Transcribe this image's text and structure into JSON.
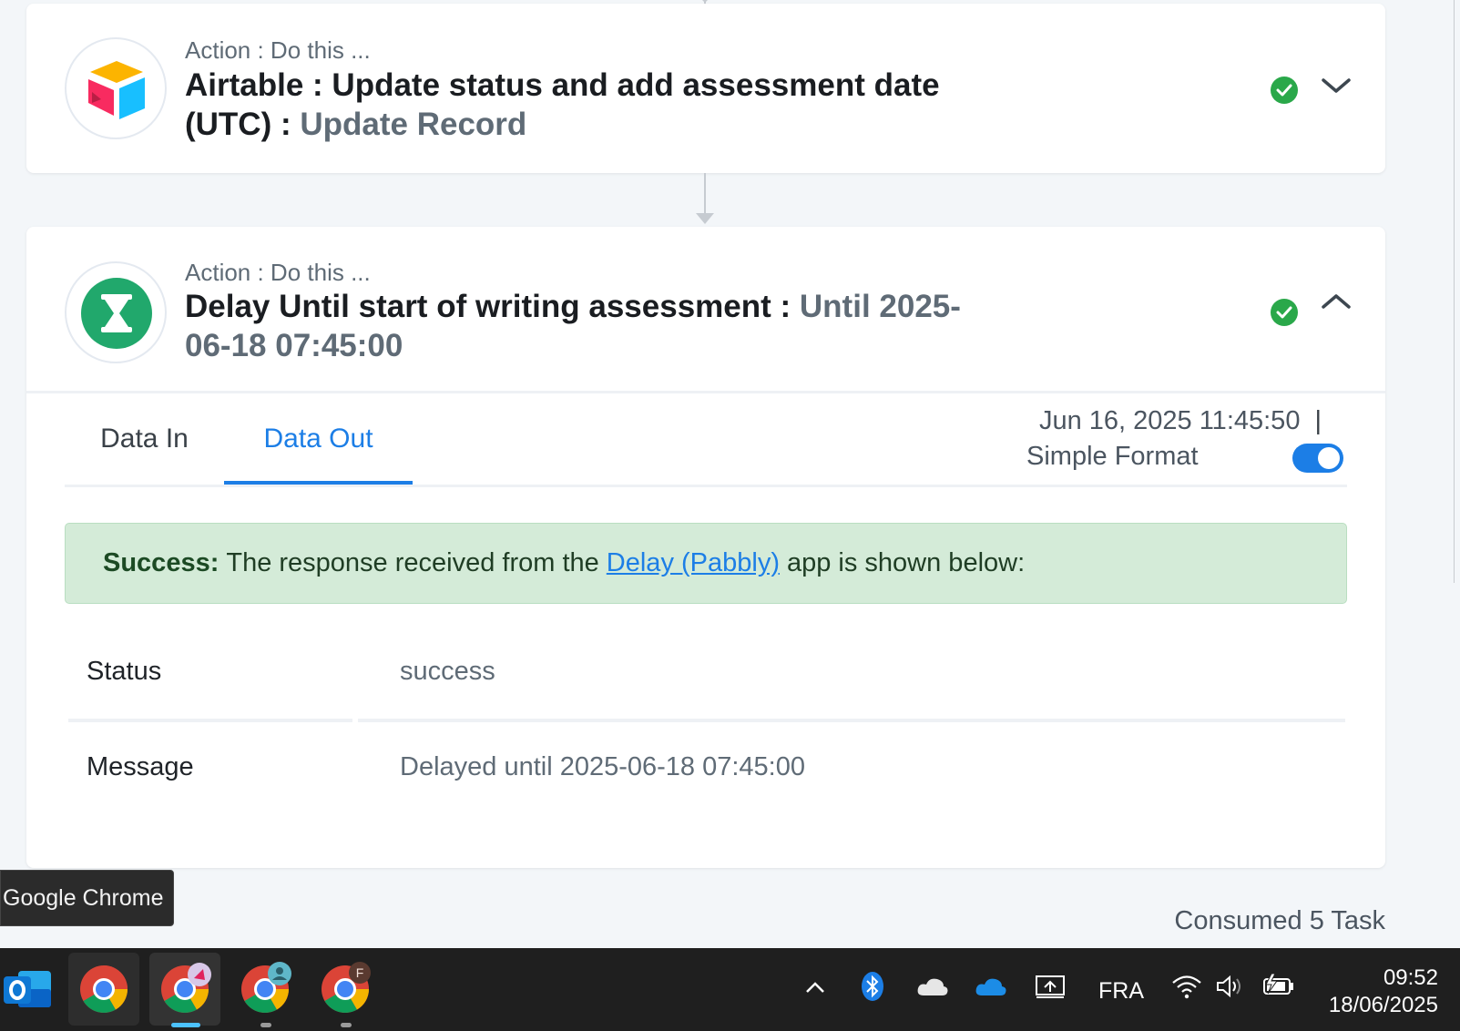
{
  "steps": [
    {
      "kicker": "Action : Do this ...",
      "app": "Airtable",
      "title_main": "Airtable : Update status and add assessment date (UTC) : ",
      "title_action": "Update Record",
      "status": "success",
      "expanded": false
    },
    {
      "kicker": "Action : Do this ...",
      "app": "Delay (Pabbly)",
      "title_main": "Delay Until start of writing assessment : ",
      "title_action": "Until 2025-06-18 07:45:00",
      "status": "success",
      "expanded": true,
      "tabs": [
        "Data In",
        "Data Out"
      ],
      "active_tab": "Data Out",
      "timestamp": "Jun 16, 2025 11:45:50",
      "timestamp_sep": "|",
      "format_label": "Simple Format",
      "format_toggle_on": true,
      "alert": {
        "label": "Success:",
        "text_before": "The response received from the",
        "link": "Delay (Pabbly)",
        "text_after": "app is shown below:"
      },
      "fields": [
        {
          "key": "Status",
          "value": "success"
        },
        {
          "key": "Message",
          "value": "Delayed until 2025-06-18 07:45:00"
        }
      ]
    }
  ],
  "tooltip": "Google Chrome",
  "consumed": "Consumed 5 Task",
  "taskbar": {
    "apps": [
      "outlook-icon",
      "chrome-icon",
      "chrome-icon",
      "chrome-icon",
      "chrome-icon"
    ],
    "chrome_profile_f_letter": "F",
    "language": "FRA",
    "time": "09:52",
    "date": "18/06/2025"
  },
  "colors": {
    "accent": "#1c7ee6",
    "success": "#2aa84a",
    "alert_bg": "#d4ebd8",
    "delay_green": "#21a86c"
  }
}
